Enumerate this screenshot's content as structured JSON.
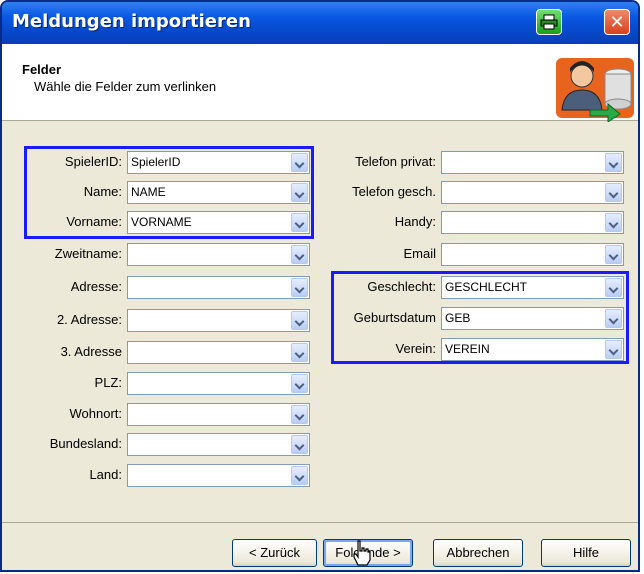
{
  "window": {
    "title": "Meldungen importieren",
    "close_glyph": "✕"
  },
  "header": {
    "title": "Felder",
    "subtitle": "Wähle die Felder zum verlinken"
  },
  "left_fields": [
    {
      "label": "SpielerID:",
      "value": "SpielerID"
    },
    {
      "label": "Name:",
      "value": "NAME"
    },
    {
      "label": "Vorname:",
      "value": "VORNAME"
    },
    {
      "label": "Zweitname:",
      "value": ""
    },
    {
      "label": "Adresse:",
      "value": ""
    },
    {
      "label": "2. Adresse:",
      "value": ""
    },
    {
      "label": "3. Adresse",
      "value": ""
    },
    {
      "label": "PLZ:",
      "value": ""
    },
    {
      "label": "Wohnort:",
      "value": ""
    },
    {
      "label": "Bundesland:",
      "value": ""
    },
    {
      "label": "Land:",
      "value": ""
    }
  ],
  "right_fields": [
    {
      "label": "Telefon privat:",
      "value": ""
    },
    {
      "label": "Telefon gesch.",
      "value": ""
    },
    {
      "label": "Handy:",
      "value": ""
    },
    {
      "label": "Email",
      "value": ""
    },
    {
      "label": "Geschlecht:",
      "value": "GESCHLECHT"
    },
    {
      "label": "Geburtsdatum",
      "value": "GEB"
    },
    {
      "label": "Verein:",
      "value": "VEREIN"
    }
  ],
  "buttons": {
    "back": "< Zurück",
    "next": "Folgende >",
    "cancel": "Abbrechen",
    "help": "Hilfe"
  },
  "colors": {
    "titlebar": "#0a58e2",
    "highlight": "#1a1aff",
    "dialog_bg": "#ece9d8"
  },
  "icons": [
    "printer-icon",
    "close-icon",
    "wizard-user-database-icon",
    "dropdown-arrow-icon",
    "hand-cursor-icon"
  ]
}
